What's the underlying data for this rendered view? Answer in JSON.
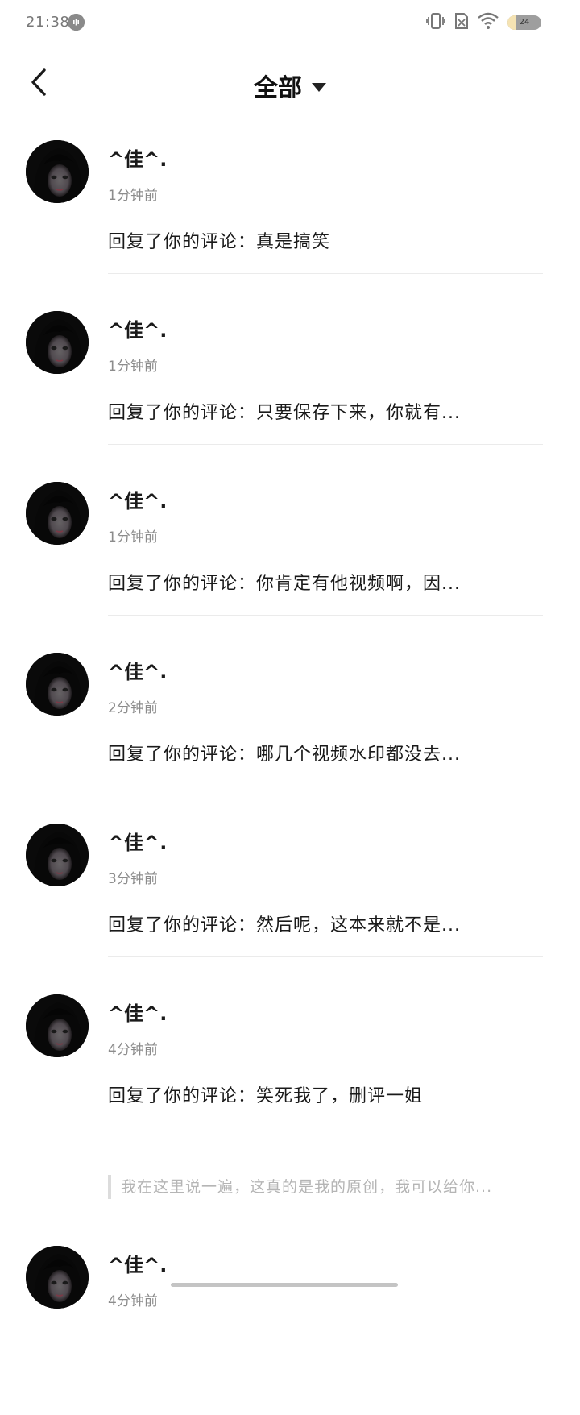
{
  "status_bar": {
    "time": "21:38",
    "notification_icon": "voice-bubble-icon",
    "icons": [
      "vibrate-icon",
      "no-sim-icon",
      "wifi-icon"
    ],
    "battery_level": "24",
    "battery_fraction": 0.24
  },
  "header": {
    "back_icon": "chevron-left-icon",
    "title": "全部",
    "dropdown_icon": "caret-down-icon"
  },
  "notifications": [
    {
      "username": "^佳^.",
      "time": "1分钟前",
      "content": "回复了你的评论：真是搞笑"
    },
    {
      "username": "^佳^.",
      "time": "1分钟前",
      "content": "回复了你的评论：只要保存下来，你就有..."
    },
    {
      "username": "^佳^.",
      "time": "1分钟前",
      "content": "回复了你的评论：你肯定有他视频啊，因..."
    },
    {
      "username": "^佳^.",
      "time": "2分钟前",
      "content": "回复了你的评论：哪几个视频水印都没去..."
    },
    {
      "username": "^佳^.",
      "time": "3分钟前",
      "content": "回复了你的评论：然后呢，这本来就不是..."
    },
    {
      "username": "^佳^.",
      "time": "4分钟前",
      "content": "回复了你的评论：笑死我了，删评一姐",
      "quote": "我在这里说一遍，这真的是我的原创，我可以给你..."
    },
    {
      "username": "^佳^.",
      "time": "4分钟前",
      "content": ""
    }
  ]
}
